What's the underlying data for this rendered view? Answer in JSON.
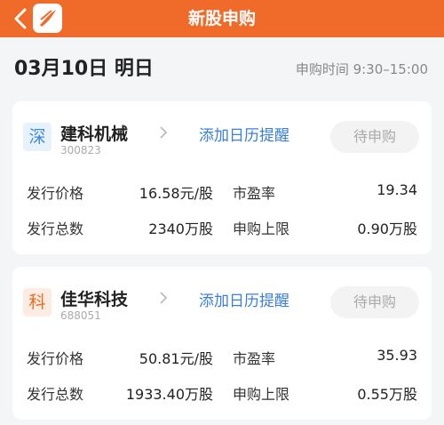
{
  "header": {
    "title": "新股申购"
  },
  "date_row": {
    "date": "03月10日 明日",
    "time": "申购时间 9:30–15:00"
  },
  "stocks": [
    {
      "badge": "深",
      "name": "建科机械",
      "code": "300823",
      "calendar_link": "添加日历提醒",
      "status": "待申购",
      "fields": {
        "price_label": "发行价格",
        "price": "16.58元/股",
        "pe_label": "市盈率",
        "pe": "19.34",
        "total_label": "发行总数",
        "total": "2340万股",
        "limit_label": "申购上限",
        "limit": "0.90万股"
      }
    },
    {
      "badge": "科",
      "name": "佳华科技",
      "code": "688051",
      "calendar_link": "添加日历提醒",
      "status": "待申购",
      "fields": {
        "price_label": "发行价格",
        "price": "50.81元/股",
        "pe_label": "市盈率",
        "pe": "35.93",
        "total_label": "发行总数",
        "total": "1933.40万股",
        "limit_label": "申购上限",
        "limit": "0.55万股"
      }
    }
  ],
  "colors": {
    "header": "#f06a2a",
    "link": "#3a7fd8",
    "shen_badge": "#3e8ad6",
    "ke_badge": "#ef6a22"
  },
  "icons": {
    "back": "chevron-left-icon",
    "logo": "app-logo-icon",
    "detail": "chevron-right-icon"
  }
}
